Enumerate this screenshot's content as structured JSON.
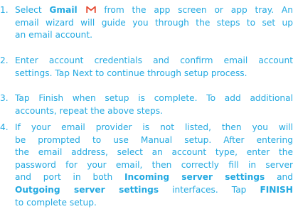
{
  "accent_color": "#23a9e1",
  "gmail_icon_color": "#e5472e",
  "steps": [
    {
      "number": "1.",
      "lines": [
        {
          "pre": "Select ",
          "bold": "Gmail",
          "icon": "gmail-icon",
          "post": " from the app screen or app tray. An"
        },
        {
          "text": "email wizard will guide you through the steps to set up"
        },
        {
          "text": "an email account."
        }
      ]
    },
    {
      "number": "2.",
      "lines": [
        {
          "text": "Enter account credentials and confirm email account"
        },
        {
          "text": "settings. Tap Next to continue through setup process."
        }
      ]
    },
    {
      "number": "3.",
      "lines": [
        {
          "text": "Tap Finish when setup is complete. To add additional"
        },
        {
          "text": "accounts, repeat the above steps."
        }
      ]
    },
    {
      "number": "4.",
      "lines": [
        {
          "text": "If your email provider is not listed, then you will"
        },
        {
          "text": "be prompted to use Manual setup. After entering"
        },
        {
          "text": "the email address, select an account type, enter the"
        },
        {
          "text": "password for your email, then correctly fill in server"
        },
        {
          "pre": "and port in both ",
          "bold": "Incoming server settings",
          "post": " and"
        },
        {
          "bold": "Outgoing server settings",
          "post": " interfaces. Tap ",
          "bold2": "FINISH"
        },
        {
          "text": "to complete setup."
        }
      ]
    }
  ]
}
